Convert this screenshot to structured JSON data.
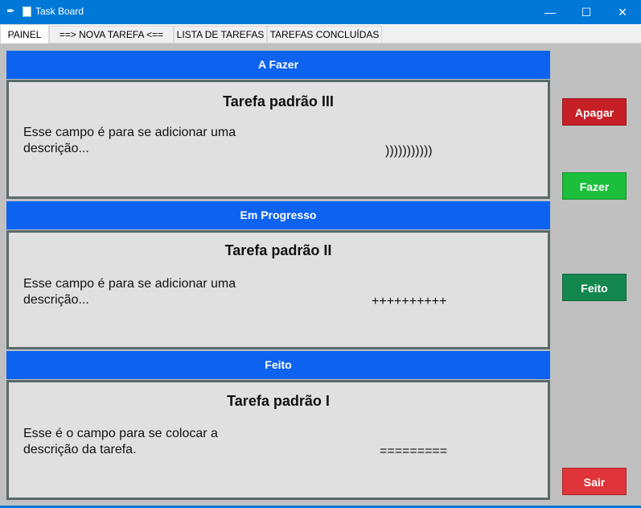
{
  "window": {
    "title": "Task Board",
    "minimize": "—",
    "maximize": "☐",
    "close": "✕"
  },
  "tabs": [
    {
      "label": "PAINEL"
    },
    {
      "label": "==> NOVA TAREFA <=="
    },
    {
      "label": "LISTA DE TAREFAS"
    },
    {
      "label": "TAREFAS CONCLUÍDAS"
    }
  ],
  "sections": [
    {
      "header": "A Fazer",
      "task_title": "Tarefa padrão III",
      "description": "Esse campo é para se adicionar uma descrição...",
      "status_mark": ")))))))))))"
    },
    {
      "header": "Em Progresso",
      "task_title": "Tarefa padrão II",
      "description": "Esse campo é para se adicionar uma descrição...",
      "status_mark": "++++++++++"
    },
    {
      "header": "Feito",
      "task_title": "Tarefa padrão I",
      "description": "Esse é o campo para se colocar a descrição da tarefa.",
      "status_mark": "========="
    }
  ],
  "buttons": {
    "delete": "Apagar",
    "todo": "Fazer",
    "done": "Feito",
    "exit": "Sair"
  },
  "colors": {
    "titlebar": "#0078d7",
    "header": "#0d63f0",
    "delete": "#c62026",
    "todo": "#1bbf3b",
    "done": "#14874f",
    "exit": "#e0343a"
  }
}
